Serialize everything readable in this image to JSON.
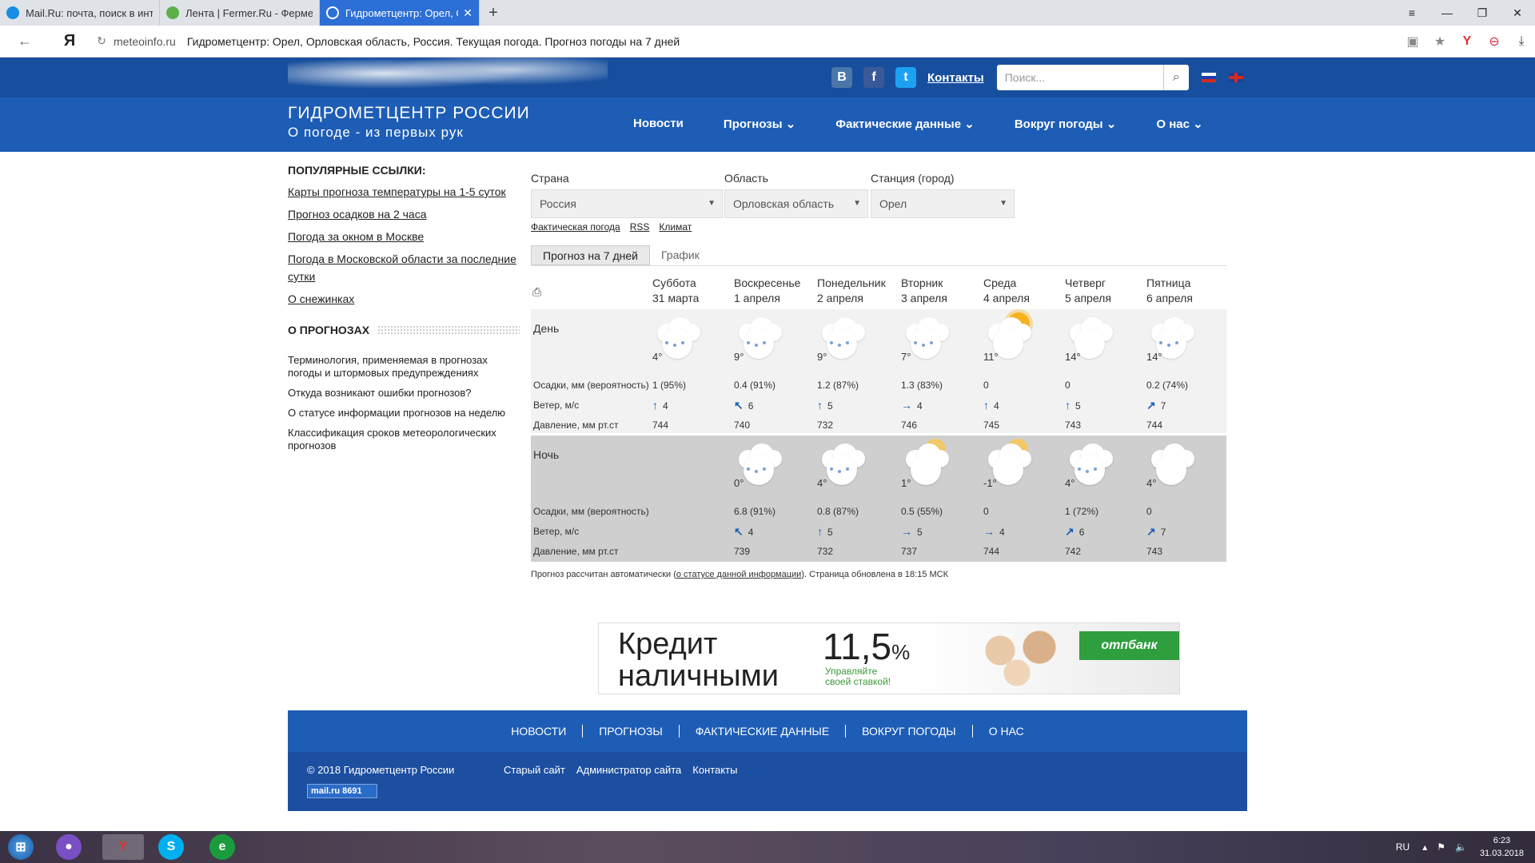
{
  "browser": {
    "tabs": [
      {
        "title": "Mail.Ru: почта, поиск в инт",
        "active": false,
        "icon": "mailru-favicon",
        "color": "#168de2"
      },
      {
        "title": "Лента | Fermer.Ru - Фермер",
        "active": false,
        "icon": "fermer-favicon",
        "color": "#5bb04a"
      },
      {
        "title": "Гидрометцентр: Орел, О",
        "active": true,
        "icon": "globe-favicon",
        "color": "#ffffff"
      }
    ],
    "address": {
      "domain": "meteoinfo.ru",
      "title": "Гидрометцентр: Орел, Орловская область, Россия. Текущая погода. Прогноз погоды на 7 дней"
    }
  },
  "site": {
    "logo_line1": "ГИДРОМЕТЦЕНТР РОССИИ",
    "logo_line2": "О погоде - из первых рук",
    "contacts": "Контакты",
    "search_placeholder": "Поиск...",
    "nav": [
      "Новости",
      "Прогнозы ⌄",
      "Фактические данные ⌄",
      "Вокруг погоды ⌄",
      "О нас ⌄"
    ],
    "social": [
      {
        "label": "В",
        "color": "#4a76a8"
      },
      {
        "label": "f",
        "color": "#3b5998"
      },
      {
        "label": "t",
        "color": "#1da1f2"
      }
    ]
  },
  "sidebar": {
    "popular_title": "ПОПУЛЯРНЫЕ ССЫЛКИ:",
    "popular": [
      "Карты прогноза температуры на 1-5 суток",
      "Прогноз осадков на 2 часа",
      "Погода за окном в Москве",
      "Погода в Московской области за последние сутки",
      "О снежинках"
    ],
    "about_title": "О ПРОГНОЗАХ",
    "about": [
      "Терминология, применяемая в прогнозах погоды и штормовых предупреждениях",
      "Откуда возникают ошибки прогнозов?",
      "О статусе информации прогнозов на неделю",
      "Классификация сроков метеорологических прогнозов"
    ]
  },
  "filters": {
    "country_label": "Страна",
    "country_value": "Россия",
    "region_label": "Область",
    "region_value": "Орловская область",
    "station_label": "Станция (город)",
    "station_value": "Орел",
    "links": [
      "Фактическая погода",
      "RSS",
      "Климат"
    ]
  },
  "forecast": {
    "tabs": [
      "Прогноз на 7 дней",
      "График"
    ],
    "days": [
      {
        "dow": "Суббота",
        "date": "31 марта"
      },
      {
        "dow": "Воскресенье",
        "date": "1 апреля"
      },
      {
        "dow": "Понедельник",
        "date": "2 апреля"
      },
      {
        "dow": "Вторник",
        "date": "3 апреля"
      },
      {
        "dow": "Среда",
        "date": "4 апреля"
      },
      {
        "dow": "Четверг",
        "date": "5 апреля"
      },
      {
        "dow": "Пятница",
        "date": "6 апреля"
      }
    ],
    "row_labels": {
      "day": "День",
      "night": "Ночь",
      "precip": "Осадки, мм (вероятность)",
      "wind": "Ветер, м/с",
      "pressure": "Давление, мм рт.ст"
    },
    "day": {
      "icons": [
        "cloud-snow-icon",
        "cloud-snow-icon",
        "cloud-snow-icon",
        "cloud-snow-icon",
        "sun-cloud-icon",
        "cloud-icon",
        "cloud-snow-icon"
      ],
      "temps": [
        "4°",
        "9°",
        "9°",
        "7°",
        "11°",
        "14°",
        "14°"
      ],
      "precip": [
        "1 (95%)",
        "0.4 (91%)",
        "1.2 (87%)",
        "1.3 (83%)",
        "0",
        "0",
        "0.2 (74%)"
      ],
      "wind": [
        [
          "↑",
          "4"
        ],
        [
          "↖",
          "6"
        ],
        [
          "↑",
          "5"
        ],
        [
          "→",
          "4"
        ],
        [
          "↑",
          "4"
        ],
        [
          "↑",
          "5"
        ],
        [
          "↗",
          "7"
        ]
      ],
      "pressure": [
        "744",
        "740",
        "732",
        "746",
        "745",
        "743",
        "744"
      ]
    },
    "night": {
      "icons": [
        "",
        "cloud-snow-icon",
        "cloud-snow-icon",
        "moon-cloud-icon",
        "moon-cloud-icon",
        "cloud-snow-icon",
        "cloud-icon"
      ],
      "temps": [
        "",
        "0°",
        "4°",
        "1°",
        "-1°",
        "4°",
        "4°"
      ],
      "precip": [
        "",
        "6.8 (91%)",
        "0.8 (87%)",
        "0.5 (55%)",
        "0",
        "1 (72%)",
        "0"
      ],
      "wind": [
        [
          "",
          ""
        ],
        [
          "↖",
          "4"
        ],
        [
          "↑",
          "5"
        ],
        [
          "→",
          "5"
        ],
        [
          "→",
          "4"
        ],
        [
          "↗",
          "6"
        ],
        [
          "↗",
          "7"
        ]
      ],
      "pressure": [
        "",
        "739",
        "732",
        "737",
        "744",
        "742",
        "743"
      ]
    },
    "note_before": "Прогноз рассчитан автоматически (",
    "note_link": "о статусе данной информации",
    "note_after": "). Страница обновлена в 18:15 МСК"
  },
  "banner": {
    "line1": "Кредит",
    "line2": "наличными",
    "rate": "11,5",
    "rate_unit": "%",
    "sub1": "Управляйте",
    "sub2": "своей ставкой!",
    "bank": "отпбанк"
  },
  "footer": {
    "nav": [
      "НОВОСТИ",
      "ПРОГНОЗЫ",
      "ФАКТИЧЕСКИЕ ДАННЫЕ",
      "ВОКРУГ ПОГОДЫ",
      "О НАС"
    ],
    "copyright": "© 2018 Гидрометцентр России",
    "links": [
      "Старый сайт",
      "Администратор сайта",
      "Контакты"
    ],
    "badge": "mail.ru  8691"
  },
  "taskbar": {
    "lang": "RU",
    "time": "6:23",
    "date": "31.03.2018"
  }
}
